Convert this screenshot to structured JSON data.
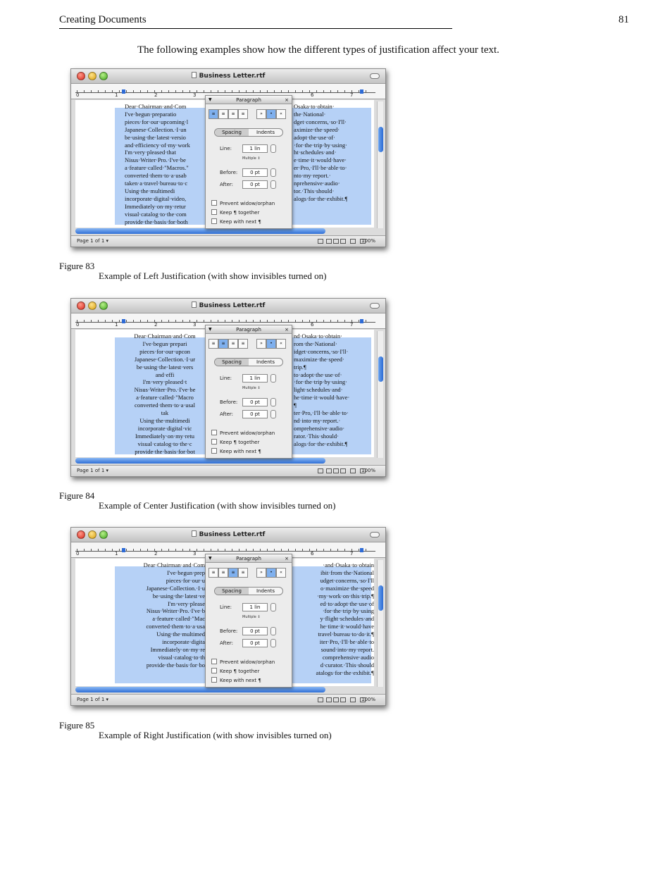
{
  "header": {
    "title": "Creating Documents",
    "page_number": "81"
  },
  "intro": "The following examples show how the different types of justification affect your text.",
  "window": {
    "title": "Business Letter.rtf",
    "ruler_numbers": [
      "0",
      "1",
      "2",
      "3",
      "6",
      "7"
    ],
    "status_page": "Page 1 of 1 ▾",
    "zoom": "100%"
  },
  "panel": {
    "title": "Paragraph",
    "close": "×",
    "tab_spacing": "Spacing",
    "tab_indents": "Indents",
    "line_label": "Line:",
    "line_value": "1 lin",
    "multiple": "Multiple",
    "before_label": "Before:",
    "before_value": "0 pt",
    "after_label": "After:",
    "after_value": "0 pt",
    "chk_widow": "Prevent widow/orphan",
    "chk_together": "Keep ¶ together",
    "chk_next": "Keep with next ¶"
  },
  "figures": [
    {
      "number": "Figure 83",
      "caption": "Example of Left Justification (with show invisibles turned on)",
      "left_lines": [
        "Dear·Chairman·and·Com",
        "    I've·begun·preparatio",
        "pieces·for·our·upcoming·l",
        "Japanese·Collection.·I·un",
        "be·using·the·latest·versio",
        "and·efficiency·of·my·work",
        "    I'm·very·pleased·that",
        "Nisus·Writer·Pro.·I've·be",
        "a·feature·called·\"Macros.\"",
        "converted·them·to·a·usab",
        "taken·a·travel·bureau·to·c",
        "    Using·the·multimedi",
        "incorporate·digital·video,",
        "Immediately·on·my·retur",
        "visual·catalog·to·the·com",
        "provide·the·basis·for·both"
      ],
      "right_lines": [
        "",
        "Osaka·to·obtain·",
        "the·National·",
        "dget·concerns,·so·I'll·",
        "aximize·the·speed·",
        "",
        "adopt·the·use·of·",
        "·for·the·trip·by·using·",
        "ht·schedules·and·",
        "e·time·it·would·have·",
        "",
        "er·Pro,·I'll·be·able·to·",
        "nto·my·report.·",
        "nprehensive·audio·",
        "tor.·This·should·",
        "alogs·for·the·exhibit.¶"
      ]
    },
    {
      "number": "Figure 84",
      "caption": "Example of Center Justification (with show invisibles turned on)",
      "left_lines": [
        "Dear·Chairman·and·Com",
        "      I've·begun·prepari",
        "   pieces·for·our·upcon",
        "Japanese·Collection.·I·ur",
        "  be·using·the·latest·vers",
        "               and·effi",
        "    I'm·very·pleased·t",
        "Nisus·Writer·Pro.·I've·be",
        "  a·feature·called·\"Macro",
        "converted·them·to·a·usal",
        "                  tak",
        "   Using·the·multimedi",
        "   incorporate·digital·vic",
        " Immediately·on·my·retu",
        "   visual·catalog·to·the·c",
        " provide·the·basis·for·bot"
      ],
      "right_lines": [
        "",
        "nd·Osaka·to·obtain·",
        "rom·the·National·",
        "idget·concerns,·so·I'll·",
        "maximize·the·speed·",
        "trip.¶",
        "to·adopt·the·use·of·",
        "·for·the·trip·by·using·",
        "light·schedules·and·",
        "he·time·it·would·have·",
        "¶",
        "ter·Pro,·I'll·be·able·to·",
        "nd·into·my·report.·",
        "omprehensive·audio·",
        "rator.·This·should·",
        "alogs·for·the·exhibit.¶"
      ]
    },
    {
      "number": "Figure 85",
      "caption": "Example of Right Justification (with show invisibles turned on)",
      "left_lines": [
        "Dear·Chairman·and·Com",
        "          I've·begun·prep",
        "            pieces·for·our·u",
        "  Japanese·Collection.·I·u",
        "     be·using·the·latest·ve",
        "",
        "         I'm·very·please",
        "  Nisus·Writer·Pro.·I've·b",
        "     a·feature·called·\"Mac",
        "   converted·them·to·a·usa",
        "",
        "        Using·the·multimed",
        "           incorporate·digita",
        "    Immediately·on·my·re",
        "          visual·catalog·to·th",
        "    provide·the·basis·for·bo"
      ],
      "right_lines": [
        "",
        "·and·Osaka·to·obtain",
        "ibit·from·the·National",
        "udget·concerns,·so·I'll",
        "o·maximize·the·speed",
        "·my·work·on·this·trip.¶",
        "ed·to·adopt·the·use·of",
        "·for·the·trip·by·using",
        "y·flight·schedules·and",
        "he·time·it·would·have",
        "travel·bureau·to·do·it.¶",
        "iter·Pro,·I'll·be·able·to",
        "sound·into·my·report.",
        "comprehensive·audio",
        "d·curator.·This·should",
        "atalogs·for·the·exhibit.¶"
      ]
    }
  ]
}
